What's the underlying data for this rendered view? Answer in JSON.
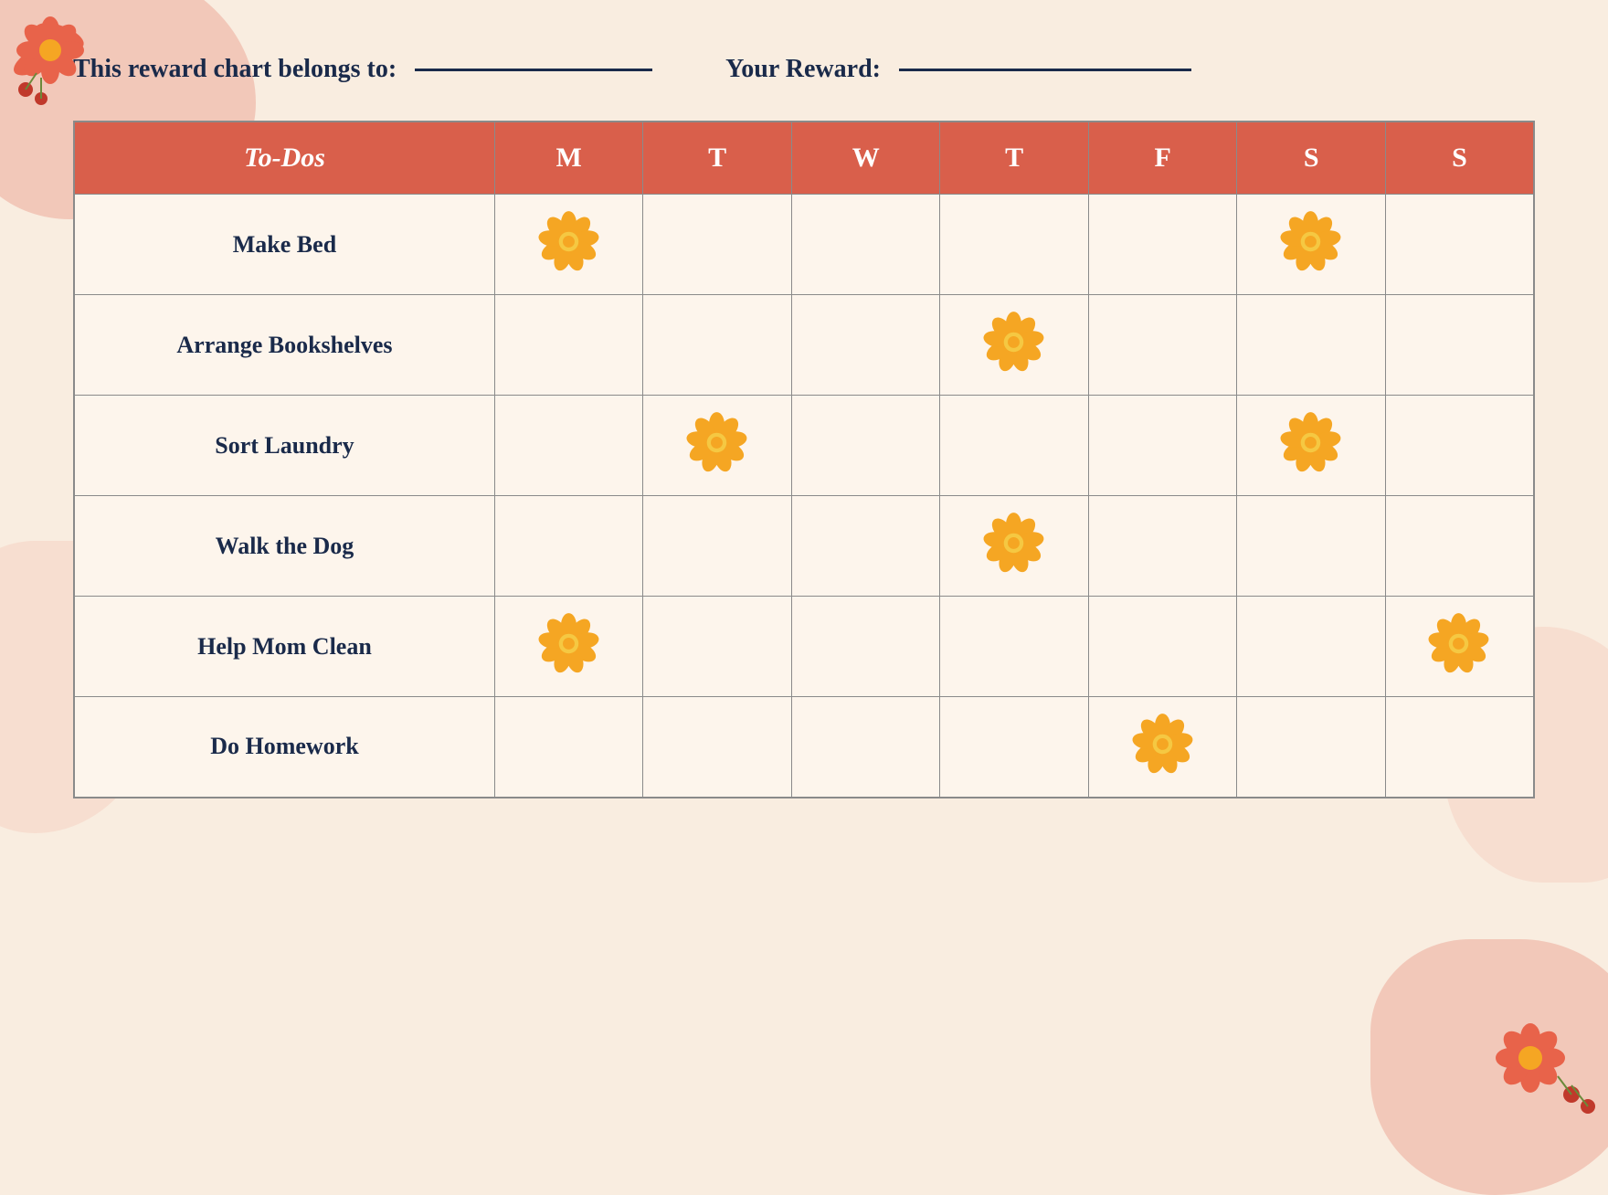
{
  "background_color": "#f9ede0",
  "header": {
    "belongs_label": "This reward chart belongs to:",
    "reward_label": "Your Reward:"
  },
  "table": {
    "columns": [
      "To-Dos",
      "M",
      "T",
      "W",
      "T",
      "F",
      "S",
      "S"
    ],
    "rows": [
      {
        "task": "Make Bed",
        "stars": [
          true,
          false,
          false,
          false,
          false,
          true,
          false
        ]
      },
      {
        "task": "Arrange Bookshelves",
        "stars": [
          false,
          false,
          false,
          true,
          false,
          false,
          false
        ]
      },
      {
        "task": "Sort Laundry",
        "stars": [
          false,
          true,
          false,
          false,
          false,
          true,
          false
        ]
      },
      {
        "task": "Walk the Dog",
        "stars": [
          false,
          false,
          false,
          true,
          false,
          false,
          false
        ]
      },
      {
        "task": "Help Mom Clean",
        "stars": [
          true,
          false,
          false,
          false,
          false,
          false,
          true
        ]
      },
      {
        "task": "Do Homework",
        "stars": [
          false,
          false,
          false,
          false,
          true,
          false,
          false
        ]
      }
    ]
  },
  "colors": {
    "header_bg": "#d95f4b",
    "header_text": "#ffffff",
    "task_text": "#1a2a4a",
    "table_bg": "#fdf5ec",
    "flower_primary": "#f5a623",
    "flower_center": "#f5c842"
  }
}
